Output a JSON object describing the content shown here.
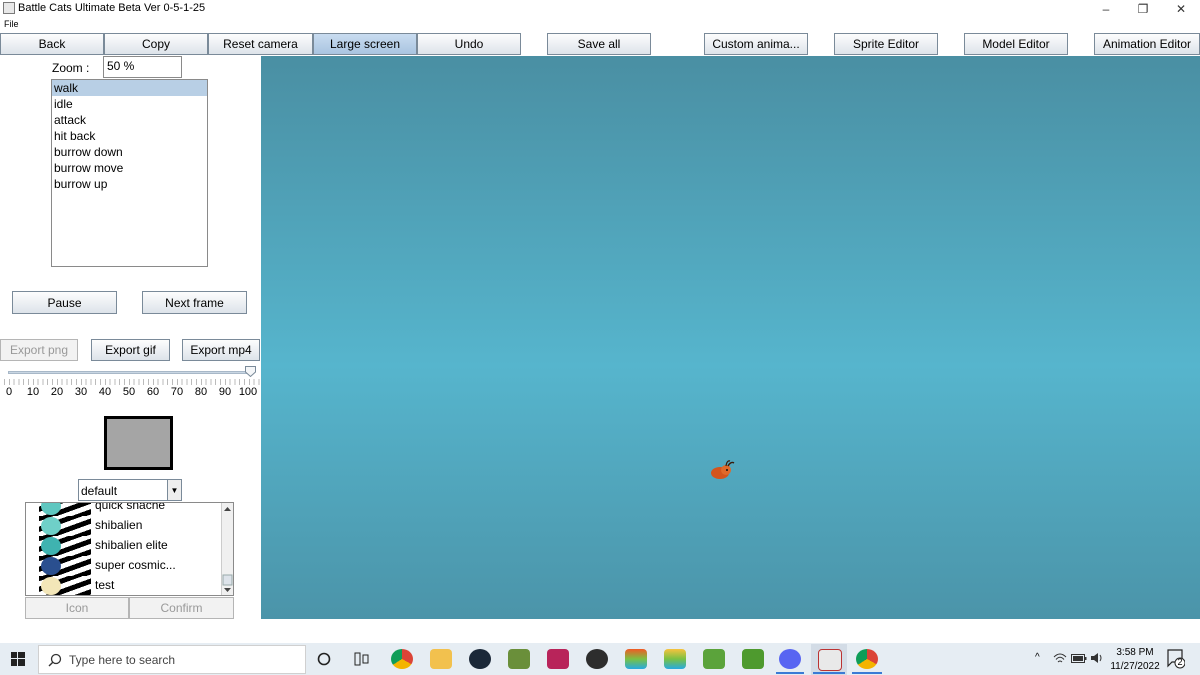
{
  "window": {
    "title": "Battle Cats Ultimate Beta Ver 0-5-1-25",
    "menu_file": "File",
    "minimize": "–",
    "restore": "❐",
    "close": "✕"
  },
  "toolbar": {
    "back": "Back",
    "copy": "Copy",
    "reset_camera": "Reset camera",
    "large_screen": "Large screen",
    "undo": "Undo",
    "save_all": "Save all",
    "custom_anim": "Custom anima...",
    "sprite_editor": "Sprite Editor",
    "model_editor": "Model Editor",
    "animation_editor": "Animation Editor"
  },
  "zoom": {
    "label": "Zoom :",
    "value": "50 %"
  },
  "animations": [
    "walk",
    "idle",
    "attack",
    "hit back",
    "burrow down",
    "burrow move",
    "burrow up"
  ],
  "selected_animation": "walk",
  "controls": {
    "pause": "Pause",
    "next_frame": "Next frame"
  },
  "export": {
    "png": "Export png",
    "gif": "Export gif",
    "mp4": "Export mp4"
  },
  "slider": {
    "ticks": [
      "0",
      "10",
      "20",
      "30",
      "40",
      "50",
      "60",
      "70",
      "80",
      "90",
      "100"
    ],
    "value": 100
  },
  "combo": {
    "value": "default",
    "arrow": "▼"
  },
  "units": [
    {
      "name": "quick snache",
      "color": "#5fc7c0"
    },
    {
      "name": "shibalien",
      "color": "#6fd0c8"
    },
    {
      "name": "shibalien elite",
      "color": "#3fb3b0"
    },
    {
      "name": "super cosmic...",
      "color": "#2a4f8f"
    },
    {
      "name": "test",
      "color": "#f3e6b8"
    }
  ],
  "unit_buttons": {
    "icon": "Icon",
    "confirm": "Confirm"
  },
  "taskbar": {
    "search_placeholder": "Type here to search",
    "time": "3:58 PM",
    "date": "11/27/2022",
    "notification_count": "2"
  },
  "colors": {
    "canvas_top": "#4a8fa3",
    "canvas_mid": "#56b5cd",
    "selection": "#b8cfe5",
    "sprite": "#d4541c"
  }
}
